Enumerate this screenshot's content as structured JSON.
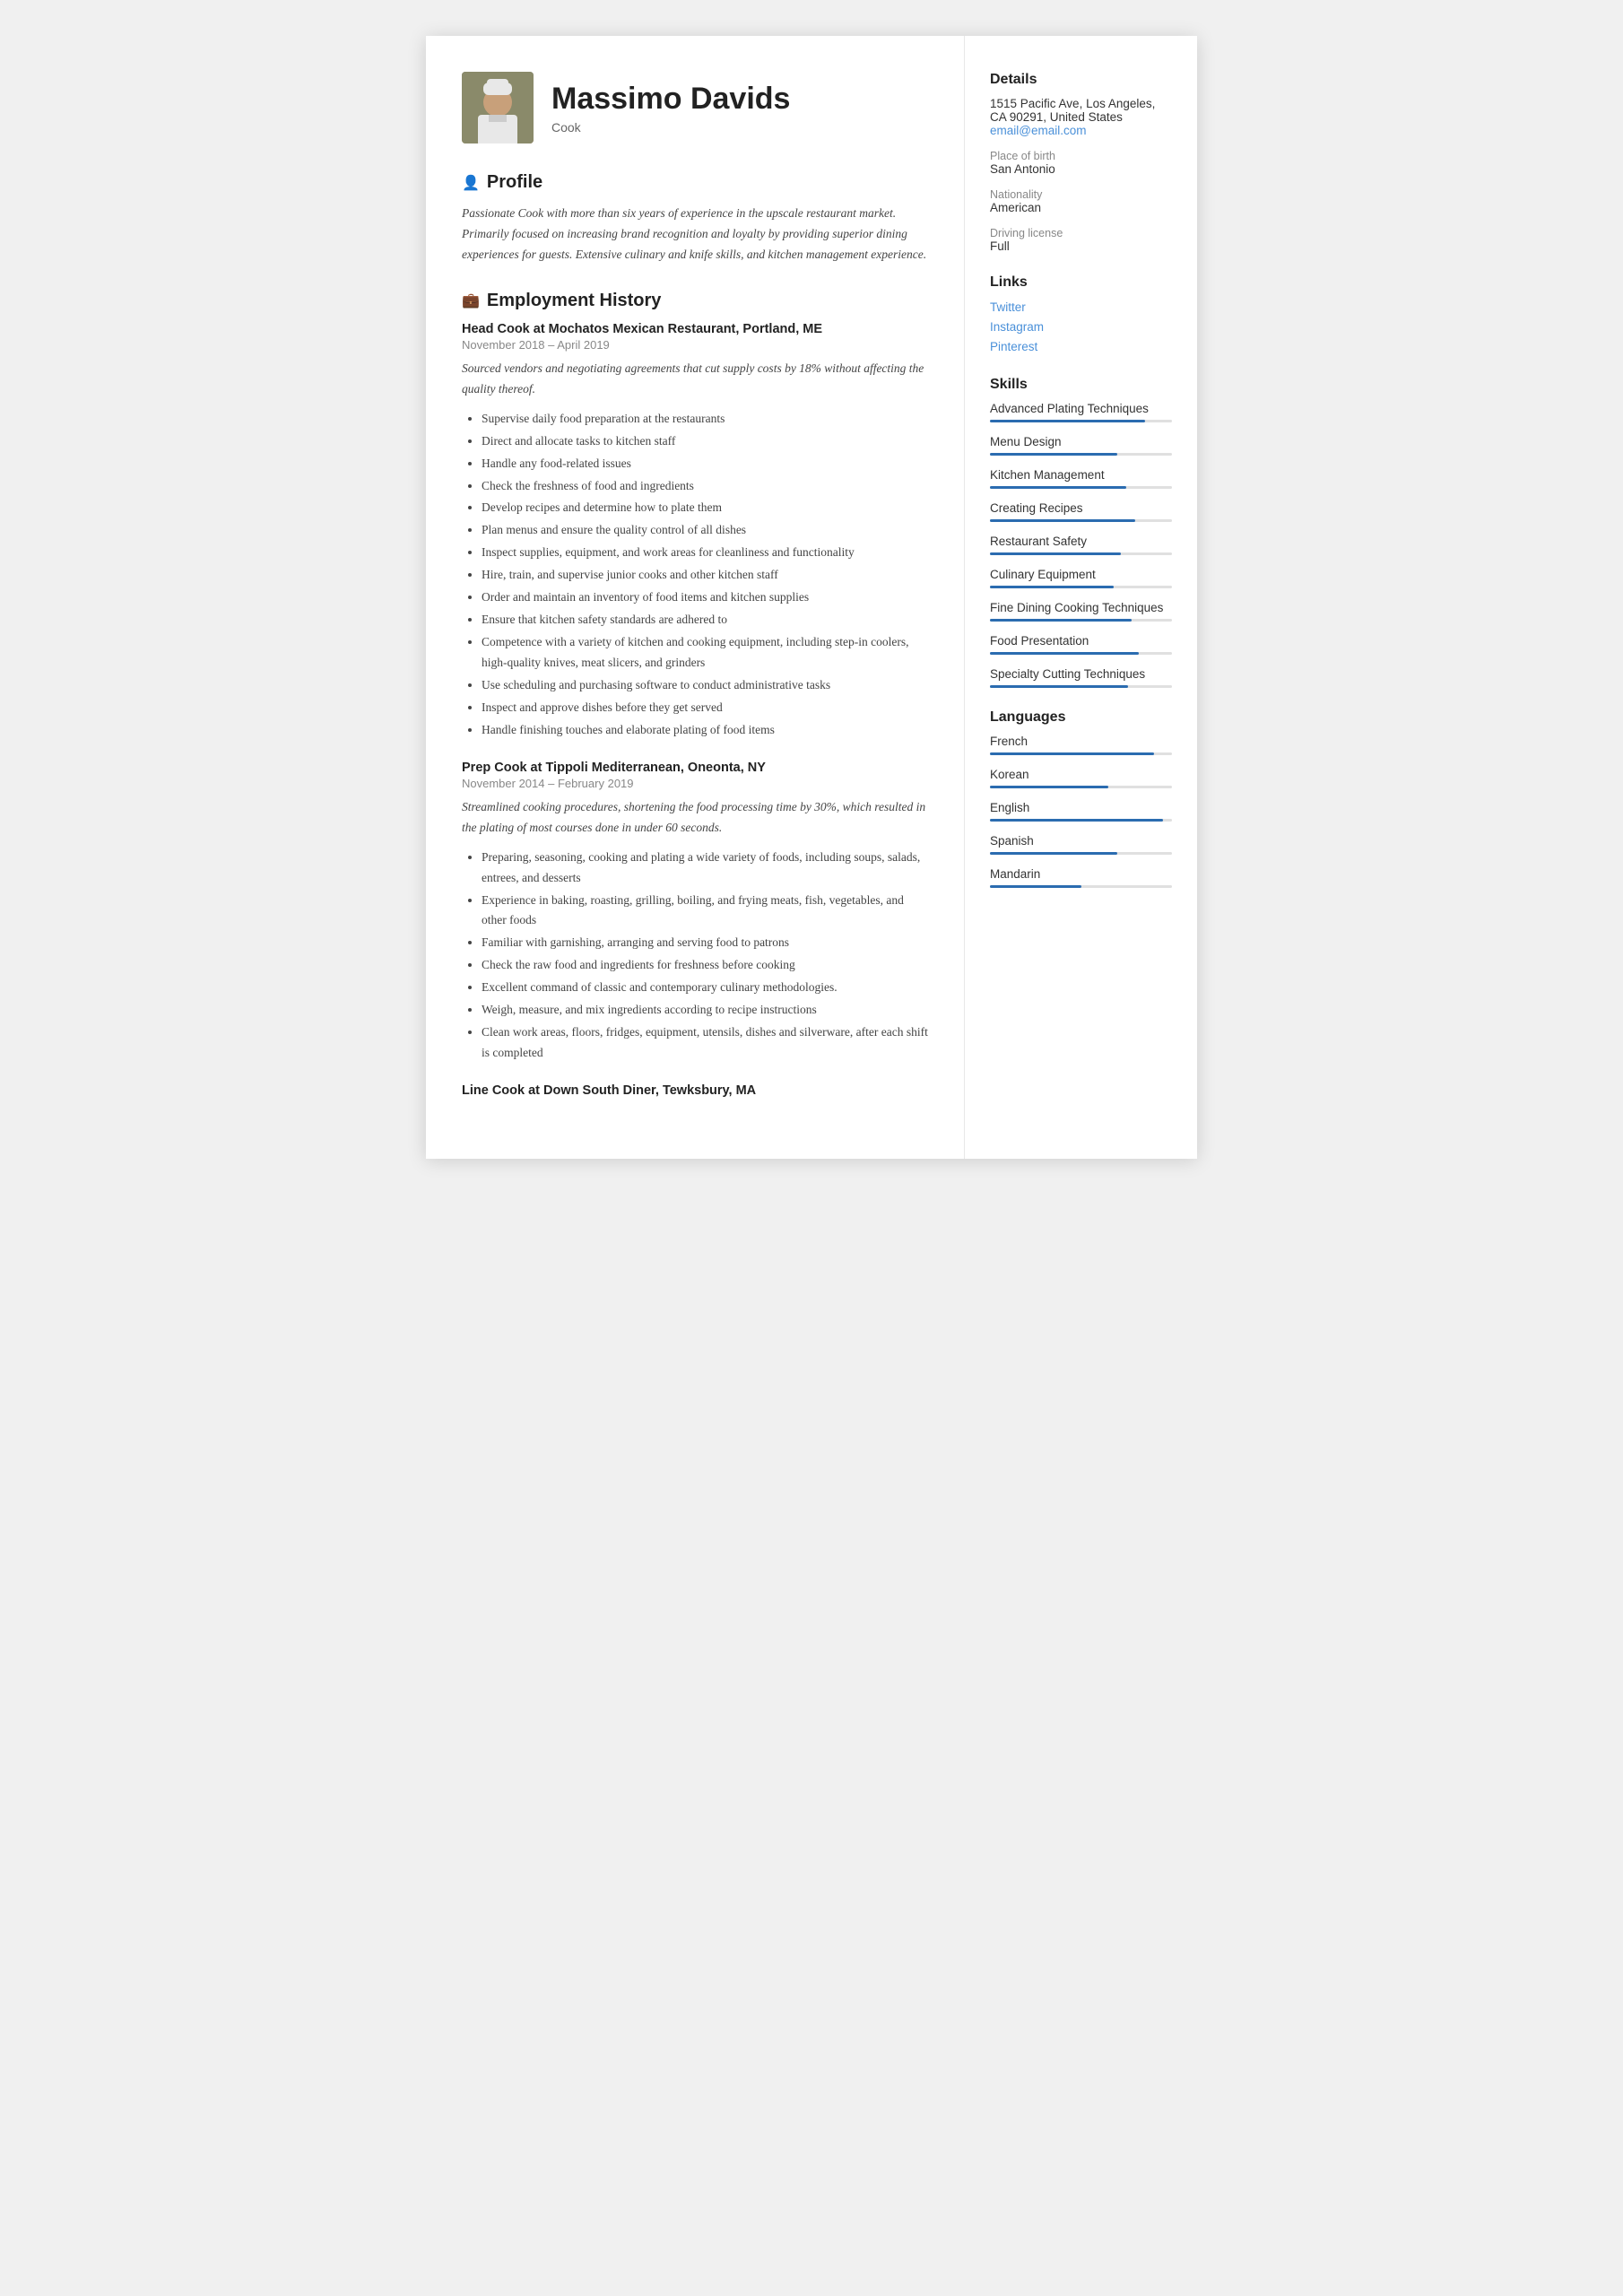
{
  "header": {
    "name": "Massimo Davids",
    "title": "Cook",
    "avatar_alt": "chef photo"
  },
  "profile": {
    "section_label": "Profile",
    "icon": "👤",
    "text": "Passionate Cook with more than six years of experience in the upscale restaurant market. Primarily focused on increasing brand recognition and loyalty by providing superior dining experiences for guests. Extensive culinary and knife skills, and kitchen management experience."
  },
  "employment": {
    "section_label": "Employment History",
    "icon": "💼",
    "jobs": [
      {
        "title": "Head Cook at Mochatos Mexican Restaurant, Portland, ME",
        "period": "November 2018 – April 2019",
        "summary": "Sourced vendors and negotiating agreements that cut supply costs by 18% without affecting the quality thereof.",
        "bullets": [
          "Supervise daily food preparation at the restaurants",
          "Direct and allocate tasks to kitchen staff",
          "Handle any food-related issues",
          "Check the freshness of food and ingredients",
          "Develop recipes and determine how to plate them",
          "Plan menus and ensure the quality control of all dishes",
          "Inspect supplies, equipment, and work areas for cleanliness and functionality",
          "Hire, train, and supervise junior cooks and other kitchen staff",
          "Order and maintain an inventory of food items and kitchen supplies",
          "Ensure that kitchen safety standards are adhered to",
          "Competence with a variety of kitchen and cooking equipment, including step-in coolers, high-quality knives, meat slicers, and grinders",
          "Use scheduling and purchasing software to conduct administrative tasks",
          "Inspect and approve dishes before they get served",
          "Handle finishing touches and elaborate plating of food items"
        ]
      },
      {
        "title": "Prep Cook at Tippoli Mediterranean, Oneonta, NY",
        "period": "November 2014 – February 2019",
        "summary": "Streamlined cooking procedures, shortening the food processing time by 30%, which resulted in the plating of most courses done in under 60 seconds.",
        "bullets": [
          "Preparing, seasoning, cooking and plating a wide variety of foods, including soups, salads, entrees, and desserts",
          "Experience in baking, roasting, grilling, boiling, and frying meats, fish, vegetables, and other foods",
          "Familiar with garnishing, arranging and serving food to patrons",
          "Check the raw food and ingredients for freshness before cooking",
          "Excellent command of classic and contemporary culinary methodologies.",
          "Weigh, measure, and mix ingredients according to recipe instructions",
          "Clean work areas, floors, fridges, equipment, utensils, dishes and silverware, after each shift is completed"
        ]
      },
      {
        "title": "Line Cook at Down South Diner, Tewksbury, MA",
        "period": "",
        "summary": "",
        "bullets": []
      }
    ]
  },
  "details": {
    "section_label": "Details",
    "address": "1515 Pacific Ave, Los Angeles, CA 90291, United States",
    "email": "email@email.com",
    "place_of_birth_label": "Place of birth",
    "place_of_birth": "San Antonio",
    "nationality_label": "Nationality",
    "nationality": "American",
    "driving_label": "Driving license",
    "driving": "Full"
  },
  "links": {
    "section_label": "Links",
    "items": [
      {
        "label": "Twitter"
      },
      {
        "label": "Instagram"
      },
      {
        "label": "Pinterest"
      }
    ]
  },
  "skills": {
    "section_label": "Skills",
    "items": [
      {
        "name": "Advanced Plating Techniques",
        "pct": 85
      },
      {
        "name": "Menu Design",
        "pct": 70
      },
      {
        "name": "Kitchen Management",
        "pct": 75
      },
      {
        "name": "Creating Recipes",
        "pct": 80
      },
      {
        "name": "Restaurant Safety",
        "pct": 72
      },
      {
        "name": "Culinary Equipment",
        "pct": 68
      },
      {
        "name": "Fine Dining Cooking Techniques",
        "pct": 78
      },
      {
        "name": "Food Presentation",
        "pct": 82
      },
      {
        "name": "Specialty Cutting Techniques",
        "pct": 76
      }
    ]
  },
  "languages": {
    "section_label": "Languages",
    "items": [
      {
        "name": "French",
        "pct": 90
      },
      {
        "name": "Korean",
        "pct": 65
      },
      {
        "name": "English",
        "pct": 95
      },
      {
        "name": "Spanish",
        "pct": 70
      },
      {
        "name": "Mandarin",
        "pct": 50
      }
    ]
  }
}
